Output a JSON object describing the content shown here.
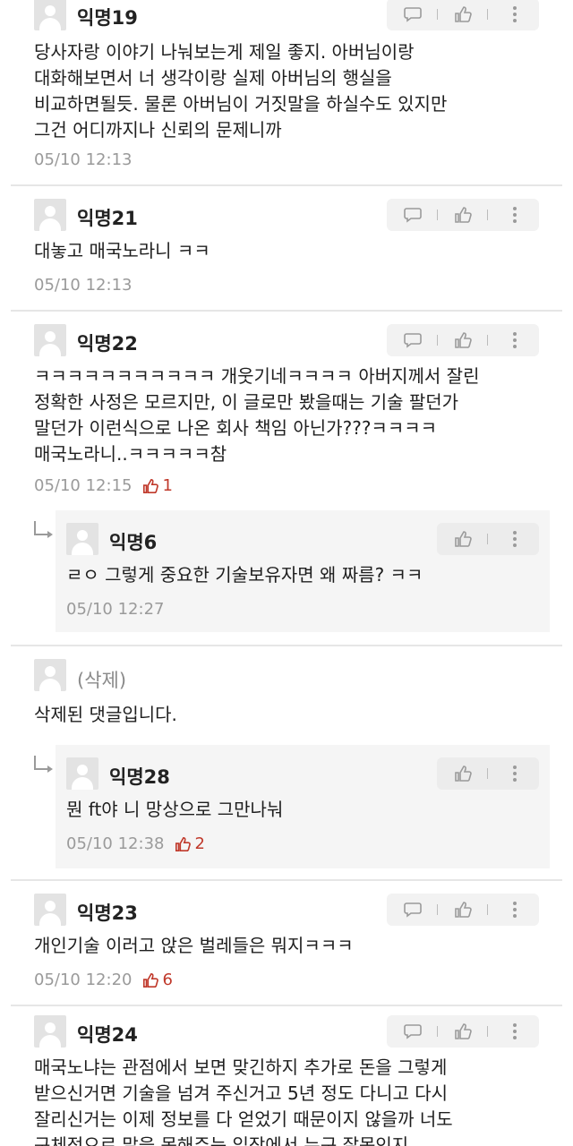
{
  "comments": [
    {
      "nick": "익명19",
      "text": "당사자랑 이야기 나눠보는게 제일 좋지. 아버님이랑\n대화해보면서 너 생각이랑 실제 아버님의 행실을\n비교하면될듯. 물론 아버님이 거짓말을 하실수도 있지만\n그건 어디까지나 신뢰의 문제니까",
      "time": "05/10 12:13"
    },
    {
      "nick": "익명21",
      "text": "대놓고 매국노라니 ㅋㅋ",
      "time": "05/10 12:13"
    },
    {
      "nick": "익명22",
      "text": "ㅋㅋㅋㅋㅋㅋㅋㅋㅋㅋㅋ 개웃기네ㅋㅋㅋㅋ 아버지께서 잘린\n정확한 사정은 모르지만, 이 글로만 봤을때는 기술 팔던가\n말던가 이런식으로 나온 회사 책임 아닌가???ㅋㅋㅋㅋ\n매국노라니..ㅋㅋㅋㅋㅋ참",
      "time": "05/10 12:15",
      "likes": "1"
    },
    {
      "nick": "익명6",
      "text": "ㄹㅇ 그렇게 중요한 기술보유자면 왜 짜름? ㅋㅋ",
      "time": "05/10 12:27"
    },
    {
      "nick": "(삭제)",
      "text": "삭제된 댓글입니다."
    },
    {
      "nick": "익명28",
      "text": "뭔 ft야 니 망상으로 그만나눠",
      "time": "05/10 12:38",
      "likes": "2"
    },
    {
      "nick": "익명23",
      "text": "개인기술 이러고 앉은 벌레들은 뭐지ㅋㅋㅋ",
      "time": "05/10 12:20",
      "likes": "6"
    },
    {
      "nick": "익명24",
      "text": "매국노냐는 관점에서 보면 맞긴하지 추가로 돈을 그렇게\n받으신거면 기술을 넘겨 주신거고 5년 정도 다니고 다시\n잘리신거는 이제 정보를 다 얻었기 때문이지 않을까 너도\n구체적으로 말을 못해주는 입장에서 누구 잘못인지"
    }
  ],
  "icons": {
    "reply": "speech-bubble-icon",
    "like": "thumbs-up-icon",
    "more": "more-vertical-icon"
  },
  "colors": {
    "accent_red": "#c0392b",
    "meta_gray": "#9a9a9a",
    "action_bg": "#f2f2f2"
  }
}
